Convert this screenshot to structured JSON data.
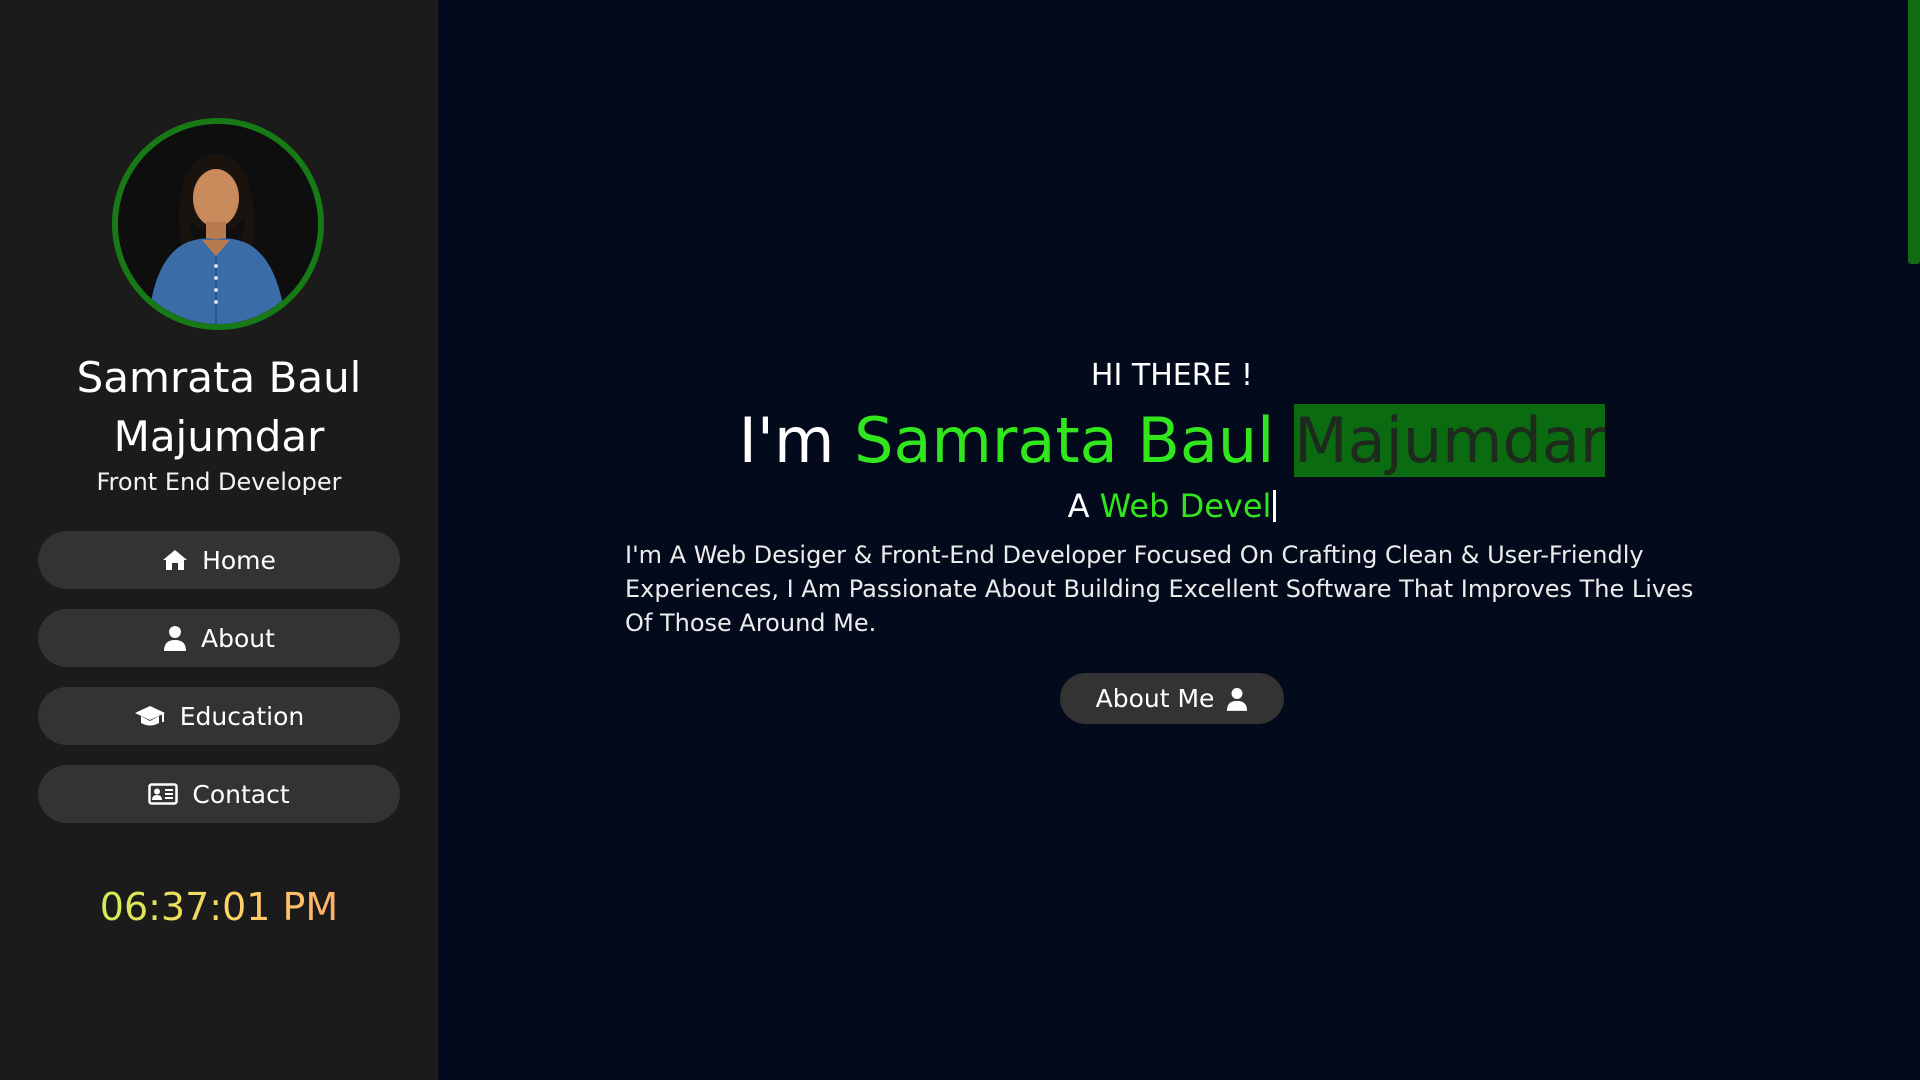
{
  "sidebar": {
    "avatar_alt": "Samrata Baul Majumdar",
    "name": "Samrata Baul Majumdar",
    "role": "Front End Developer",
    "nav": [
      {
        "label": "Home",
        "icon": "home-icon"
      },
      {
        "label": "About",
        "icon": "user-icon"
      },
      {
        "label": "Education",
        "icon": "graduation-cap-icon"
      },
      {
        "label": "Contact",
        "icon": "address-card-icon"
      }
    ],
    "clock": "06:37:01 PM"
  },
  "hero": {
    "greeting": "HI THERE !",
    "intro_prefix": "I'm",
    "name_first": "Samrata Baul",
    "name_last": "Majumdar",
    "typed_prefix": "A",
    "typed_text": "Web Devel",
    "description": "I'm A Web Desiger & Front-End Developer Focused On Crafting Clean & User-Friendly Experiences, I Am Passionate About Building Excellent Software That Improves The Lives Of Those Around Me.",
    "cta_label": "About Me",
    "cta_icon": "user-icon"
  },
  "colors": {
    "sidebar_bg": "#1b1b1b",
    "main_bg": "#020a1c",
    "accent_green": "#32e61e",
    "button_bg": "#333333",
    "selection_bg": "#0b6b10"
  }
}
